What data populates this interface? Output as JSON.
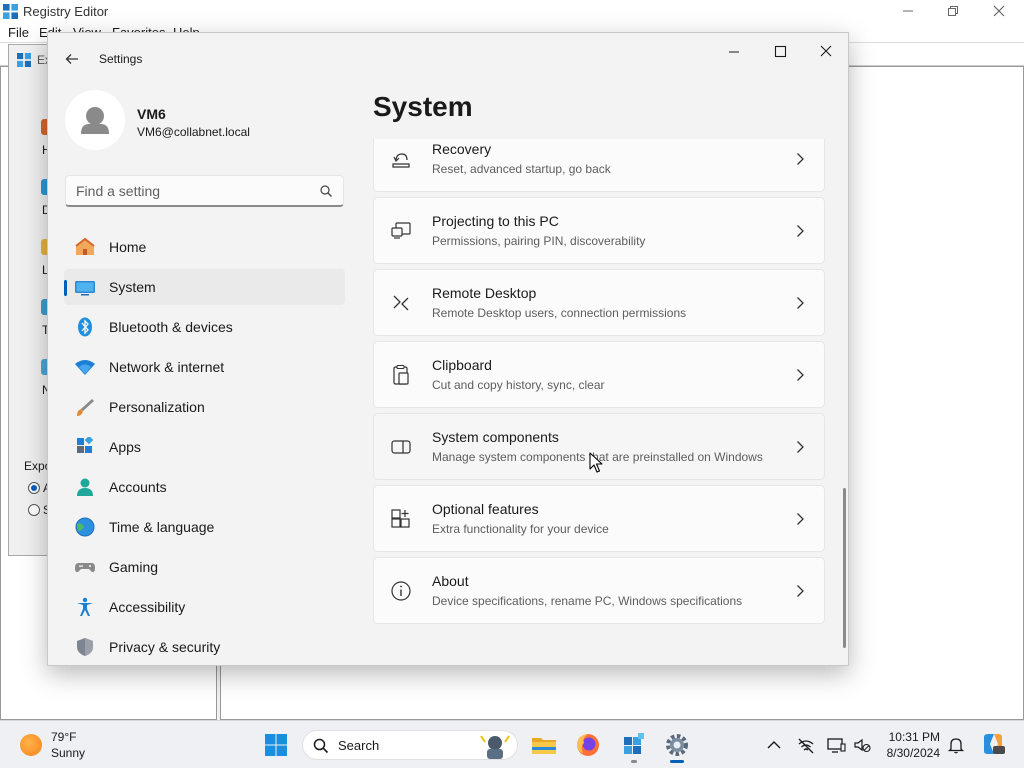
{
  "regedit": {
    "title": "Registry Editor",
    "menus": [
      "File",
      "Edit",
      "View",
      "Favorites",
      "Help"
    ],
    "window_controls": [
      "minimize-icon",
      "maximize-icon",
      "close-icon"
    ],
    "export_dialog": {
      "header_prefix": "Ex",
      "items": [
        {
          "label": "H",
          "icon": "home-icon"
        },
        {
          "label": "De",
          "icon": "desktop-icon"
        },
        {
          "label": "Lib",
          "icon": "libraries-icon"
        },
        {
          "label": "Th",
          "icon": "this-pc-icon"
        },
        {
          "label": "Ne",
          "icon": "network-icon"
        }
      ],
      "range_label": "Expo",
      "radio_all": "A",
      "radio_selected": "S"
    }
  },
  "settings": {
    "title": "Settings",
    "user": {
      "name": "VM6",
      "email": "VM6@collabnet.local"
    },
    "search": {
      "placeholder": "Find a setting"
    },
    "nav": [
      {
        "label": "Home",
        "icon": "home-icon",
        "active": false
      },
      {
        "label": "System",
        "icon": "system-icon",
        "active": true
      },
      {
        "label": "Bluetooth & devices",
        "icon": "bluetooth-icon",
        "active": false
      },
      {
        "label": "Network & internet",
        "icon": "wifi-icon",
        "active": false
      },
      {
        "label": "Personalization",
        "icon": "brush-icon",
        "active": false
      },
      {
        "label": "Apps",
        "icon": "apps-icon",
        "active": false
      },
      {
        "label": "Accounts",
        "icon": "accounts-icon",
        "active": false
      },
      {
        "label": "Time & language",
        "icon": "globe-clock-icon",
        "active": false
      },
      {
        "label": "Gaming",
        "icon": "gamepad-icon",
        "active": false
      },
      {
        "label": "Accessibility",
        "icon": "accessibility-icon",
        "active": false
      },
      {
        "label": "Privacy & security",
        "icon": "shield-icon",
        "active": false
      }
    ],
    "page_title": "System",
    "cards": [
      {
        "title": "Recovery",
        "desc": "Reset, advanced startup, go back",
        "icon": "recovery-icon"
      },
      {
        "title": "Projecting to this PC",
        "desc": "Permissions, pairing PIN, discoverability",
        "icon": "projecting-icon"
      },
      {
        "title": "Remote Desktop",
        "desc": "Remote Desktop users, connection permissions",
        "icon": "remote-desktop-icon"
      },
      {
        "title": "Clipboard",
        "desc": "Cut and copy history, sync, clear",
        "icon": "clipboard-icon"
      },
      {
        "title": "System components",
        "desc": "Manage system components that are preinstalled on Windows",
        "icon": "system-components-icon",
        "hovered": true
      },
      {
        "title": "Optional features",
        "desc": "Extra functionality for your device",
        "icon": "optional-features-icon"
      },
      {
        "title": "About",
        "desc": "Device specifications, rename PC, Windows specifications",
        "icon": "info-icon"
      }
    ]
  },
  "taskbar": {
    "weather": {
      "temp": "79°F",
      "condition": "Sunny"
    },
    "search_label": "Search",
    "apps": [
      "file-explorer-icon",
      "firefox-icon",
      "registry-editor-icon",
      "settings-icon"
    ],
    "clock": {
      "time": "10:31 PM",
      "date": "8/30/2024"
    }
  },
  "colors": {
    "accent": "#005fb8",
    "nav_active_bg": "#eaeaea",
    "window_bg": "#f3f3f3",
    "card_bg": "#fbfbfb"
  }
}
